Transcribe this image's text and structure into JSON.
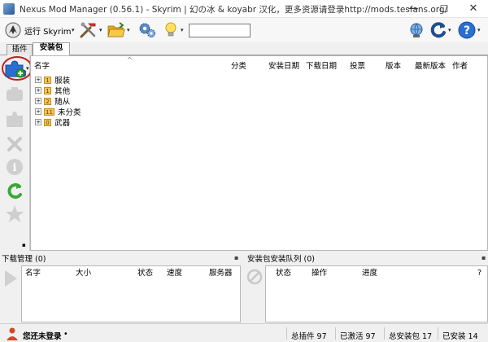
{
  "window": {
    "title": "Nexus Mod Manager (0.56.1) - Skyrim | 幻の冰 & koyabr 汉化，更多资源请登录http://mods.tesfans.org/",
    "minimize": "—",
    "maximize": "☐",
    "close": "✕"
  },
  "toolbar": {
    "run_label": "运行 Skyrim",
    "search_value": "",
    "dropdown_glyph": "▾"
  },
  "tabs": [
    {
      "label": "插件",
      "active": false
    },
    {
      "label": "安装包",
      "active": true
    }
  ],
  "mod_list": {
    "sort_arrow": "^",
    "columns": [
      "名字",
      "分类",
      "安装日期",
      "下载日期",
      "投票",
      "版本",
      "最新版本",
      "作者"
    ],
    "categories": [
      {
        "count": "1",
        "name": "服装"
      },
      {
        "count": "1",
        "name": "其他"
      },
      {
        "count": "2",
        "name": "随从"
      },
      {
        "count": "11",
        "name": "未分类"
      },
      {
        "count": "0",
        "name": "武器"
      }
    ]
  },
  "download_panel": {
    "title": "下载管理 (0)",
    "columns": [
      "名字",
      "大小",
      "状态",
      "速度",
      "服务器"
    ]
  },
  "queue_panel": {
    "title": "安装包安装队列 (0)",
    "columns": [
      "状态",
      "操作",
      "进度"
    ],
    "help": "?"
  },
  "status": {
    "login": "您还未登录",
    "login_dot": "•",
    "total_plugins": "总插件 97",
    "active": "已激活 97",
    "total_packages": "总安装包 17",
    "installed": "已安装 14"
  },
  "colors": {
    "accent_blue": "#2a6fd0",
    "highlight_circle": "#c0201f",
    "badge": "#f5c55a"
  }
}
